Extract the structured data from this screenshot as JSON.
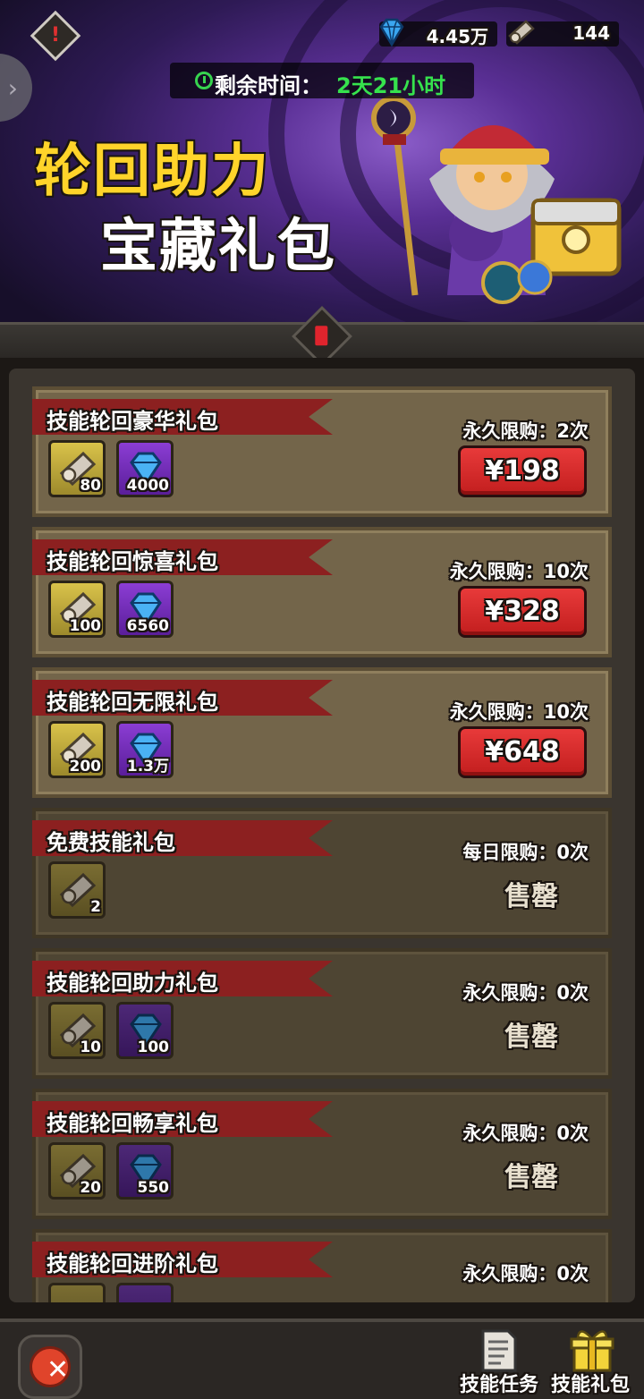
{
  "header": {
    "gems": "4.45万",
    "scrolls": "144",
    "timer_label": "剩余时间：",
    "timer_value": "2天21小时",
    "title_line1": "轮回助力",
    "title_line2": "宝藏礼包"
  },
  "packs": [
    {
      "name": "技能轮回豪华礼包",
      "limit": "永久限购：2次",
      "price": "¥198",
      "scroll_count": "80",
      "gem_count": "4000",
      "sold_out": false
    },
    {
      "name": "技能轮回惊喜礼包",
      "limit": "永久限购：10次",
      "price": "¥328",
      "scroll_count": "100",
      "gem_count": "6560",
      "sold_out": false
    },
    {
      "name": "技能轮回无限礼包",
      "limit": "永久限购：10次",
      "price": "¥648",
      "scroll_count": "200",
      "gem_count": "1.3万",
      "sold_out": false
    },
    {
      "name": "免费技能礼包",
      "limit": "每日限购：0次",
      "status": "售罄",
      "scroll_count": "2",
      "sold_out": true
    },
    {
      "name": "技能轮回助力礼包",
      "limit": "永久限购：0次",
      "status": "售罄",
      "scroll_count": "10",
      "gem_count": "100",
      "sold_out": true
    },
    {
      "name": "技能轮回畅享礼包",
      "limit": "永久限购：0次",
      "status": "售罄",
      "scroll_count": "20",
      "gem_count": "550",
      "sold_out": true
    },
    {
      "name": "技能轮回进阶礼包",
      "limit": "永久限购：0次",
      "sold_out": true
    }
  ],
  "bottom_nav": {
    "skill_tasks": "技能任务",
    "skill_packs": "技能礼包"
  },
  "icons": {
    "warning": "warning-icon",
    "gem": "diamond-icon",
    "scroll": "scroll-icon",
    "close": "close-icon",
    "tasks": "document-icon",
    "gift": "gift-icon"
  },
  "colors": {
    "title_yellow": "#ffd42a",
    "timer_green": "#36e24d",
    "price_red": "#d42828",
    "ribbon_red": "#8c2020"
  }
}
